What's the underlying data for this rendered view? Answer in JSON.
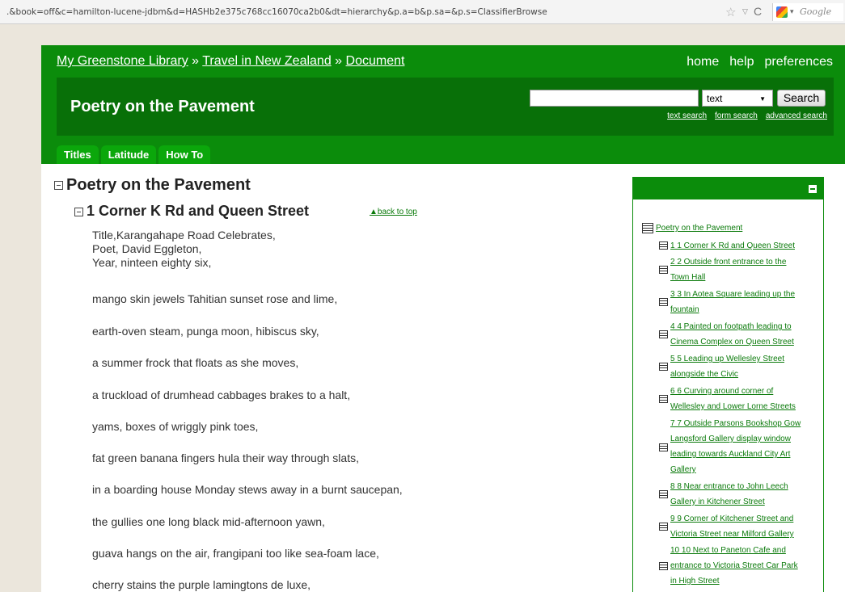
{
  "browser": {
    "url": ".&book=off&c=hamilton-lucene-jdbm&d=HASHb2e375c768cc16070ca2b0&dt=hierarchy&p.a=b&p.sa=&p.s=ClassifierBrowse",
    "search_engine": "Google"
  },
  "header": {
    "breadcrumb": {
      "home": "My Greenstone Library",
      "sep1": " » ",
      "collection": "Travel in New Zealand",
      "sep2": " » ",
      "current": "Document"
    },
    "nav": [
      "home",
      "help",
      "preferences"
    ],
    "collection_title": "Poetry on the Pavement",
    "search": {
      "input_value": "",
      "select_value": "text",
      "button_label": "Search",
      "links": [
        "text search",
        "form search",
        "advanced search"
      ]
    },
    "tabs": [
      "Titles",
      "Latitude",
      "How To"
    ]
  },
  "content": {
    "doc_title": "Poetry on the Pavement",
    "section_title": "1 Corner K Rd and Queen Street",
    "back_to_top": "▲back to top",
    "meta": [
      "Title,Karangahape Road Celebrates,",
      "Poet, David Eggleton,",
      "Year, ninteen eighty six,"
    ],
    "lines": [
      "mango skin jewels Tahitian sunset rose and lime,",
      "earth-oven steam, punga moon, hibiscus sky,",
      "a summer frock that floats as she moves,",
      "a truckload of drumhead cabbages brakes to a halt,",
      "yams, boxes of wriggly pink toes,",
      "fat green banana fingers hula their way through slats,",
      "in a boarding house Monday stews away in a burnt saucepan,",
      "the gullies one long black mid-afternoon yawn,",
      "guava hangs on the air, frangipani too like sea-foam lace,",
      "cherry stains the purple lamingtons de luxe,"
    ]
  },
  "toc": {
    "root": "Poetry on the Pavement",
    "items": [
      {
        "lines": [
          "1 1 Corner K Rd and Queen Street"
        ]
      },
      {
        "lines": [
          "2 2 Outside front entrance to the",
          "Town Hall"
        ]
      },
      {
        "lines": [
          "3 3 In Aotea Square leading up the",
          "fountain"
        ]
      },
      {
        "lines": [
          "4 4 Painted on footpath leading to",
          "Cinema Complex on Queen Street"
        ]
      },
      {
        "lines": [
          "5 5 Leading up Wellesley Street",
          "alongside the Civic"
        ]
      },
      {
        "lines": [
          "6 6 Curving around corner of",
          "Wellesley and Lower Lorne Streets"
        ]
      },
      {
        "lines": [
          "7 7 Outside Parsons Bookshop Gow",
          "Langsford Gallery display window",
          "leading towards Auckland City Art",
          "Gallery"
        ]
      },
      {
        "lines": [
          "8 8 Near entrance to John Leech",
          "Gallery in Kitchener Street"
        ]
      },
      {
        "lines": [
          "9 9 Corner of Kitchener Street and",
          "Victoria Street near Milford Gallery"
        ]
      },
      {
        "lines": [
          "10 10 Next to Paneton Cafe and",
          "entrance to Victoria Street Car Park",
          "in High Street"
        ]
      }
    ]
  }
}
